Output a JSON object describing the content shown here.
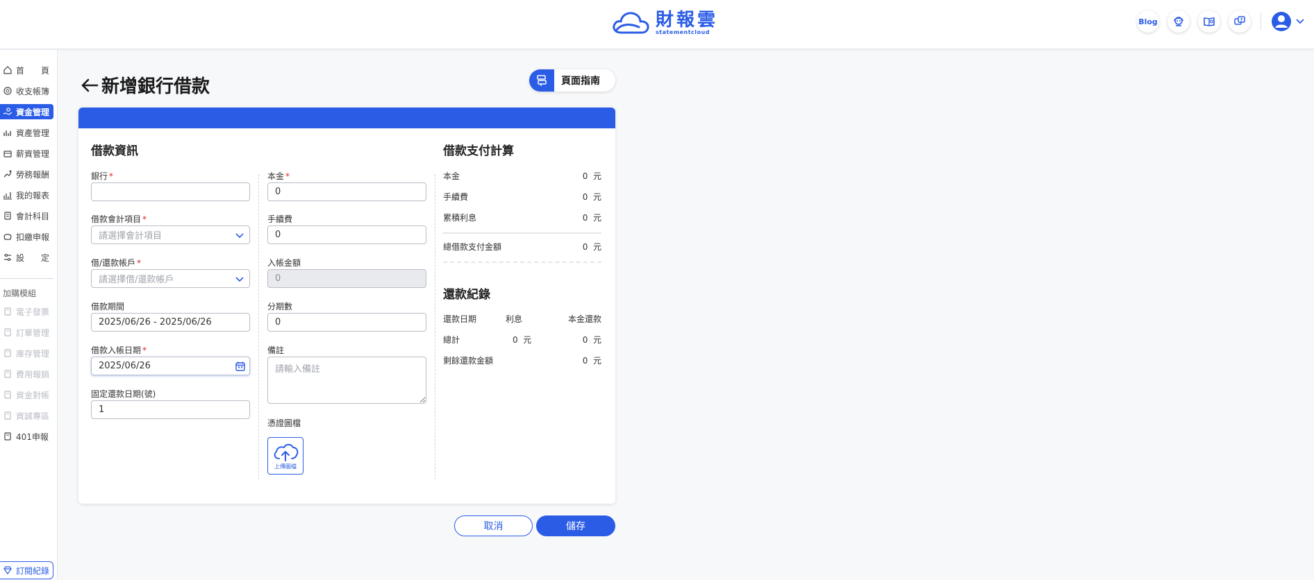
{
  "brand": {
    "name_cn": "財報雲",
    "name_en": "statementcloud",
    "color": "#2b5ce6"
  },
  "header": {
    "blog_label": "Blog"
  },
  "sidebar": {
    "items": [
      {
        "label": "首　　頁",
        "icon": "home-icon"
      },
      {
        "label": "收支帳簿",
        "icon": "coin-icon"
      },
      {
        "label": "資金管理",
        "icon": "hand-money-icon",
        "active": true
      },
      {
        "label": "資產管理",
        "icon": "asset-chart-icon"
      },
      {
        "label": "薪資管理",
        "icon": "payroll-icon"
      },
      {
        "label": "勞務報酬",
        "icon": "handshake-icon"
      },
      {
        "label": "我的報表",
        "icon": "report-icon"
      },
      {
        "label": "會計科目",
        "icon": "ledger-icon"
      },
      {
        "label": "扣繳申報",
        "icon": "withholding-icon"
      },
      {
        "label": "設　　定",
        "icon": "settings-icon"
      }
    ],
    "addon_title": "加購模組",
    "addons": [
      {
        "label": "電子發票"
      },
      {
        "label": "訂單管理"
      },
      {
        "label": "庫存管理"
      },
      {
        "label": "費用報銷"
      },
      {
        "label": "資金對帳"
      },
      {
        "label": "資誠專區"
      },
      {
        "label": "401申報",
        "enabled": true
      }
    ],
    "subscription_label": "訂閱紀錄"
  },
  "page": {
    "title": "新增銀行借款",
    "guide_label": "頁面指南"
  },
  "loan_info": {
    "section_title": "借款資訊",
    "bank_label": "銀行",
    "bank_value": "",
    "account_item_label": "借款會計項目",
    "account_item_placeholder": "請選擇會計項目",
    "repay_account_label": "借/還款帳戶",
    "repay_account_placeholder": "請選擇借/還款帳戶",
    "period_label": "借款期間",
    "period_value": "2025/06/26 - 2025/06/26",
    "deposit_date_label": "借款入帳日期",
    "deposit_date_value": "2025/06/26",
    "fixed_day_label": "固定還款日期(號)",
    "fixed_day_value": "1",
    "principal_label": "本金",
    "principal_value": "0",
    "fee_label": "手續費",
    "fee_value": "0",
    "posted_label": "入帳金額",
    "posted_value": "0",
    "installments_label": "分期數",
    "installments_value": "0",
    "note_label": "備註",
    "note_placeholder": "請輸入備註",
    "voucher_label": "憑證圖檔",
    "upload_label": "上傳圖檔"
  },
  "calc": {
    "section_title": "借款支付計算",
    "unit": "元",
    "rows": [
      {
        "label": "本金",
        "value": "0"
      },
      {
        "label": "手續費",
        "value": "0"
      },
      {
        "label": "累積利息",
        "value": "0"
      }
    ],
    "total_label": "總借款支付金額",
    "total_value": "0"
  },
  "records": {
    "section_title": "還款紀錄",
    "col_date": "還款日期",
    "col_interest": "利息",
    "col_principal": "本金還款",
    "total_label": "總計",
    "total_interest": "0",
    "total_principal": "0",
    "remaining_label": "剩餘還款金額",
    "remaining_value": "0"
  },
  "actions": {
    "cancel": "取消",
    "save": "儲存"
  }
}
